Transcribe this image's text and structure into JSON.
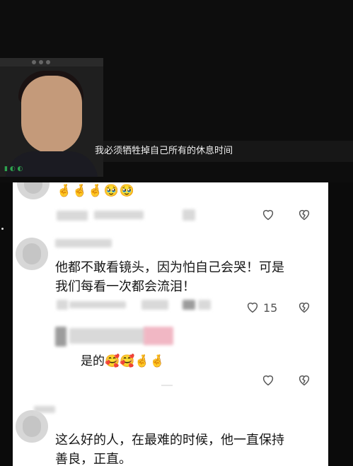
{
  "video": {
    "subtitle": "我必须牺牲掉自己所有的休息时间"
  },
  "comments": [
    {
      "text": "",
      "emoji_text": "🤞🤞🤞🥹🥹"
    },
    {
      "text_line1": "他都不敢看镜头，因为怕自己会哭！可是",
      "text_line2": "我们每看一次都会流泪！",
      "like_count": "15"
    },
    {
      "reply_text": "是的",
      "reply_emojis": "🥰🥰🤞🤞"
    },
    {
      "text_line1": "这么好的人，在最难的时候，他一直保持",
      "text_line2": "善良，正直。"
    }
  ],
  "colors": {
    "panel_bg": "#ffffff",
    "page_bg": "#0b0b0b",
    "icon_gray": "#555555"
  },
  "icons": [
    "heart-outline-icon",
    "broken-heart-icon"
  ]
}
